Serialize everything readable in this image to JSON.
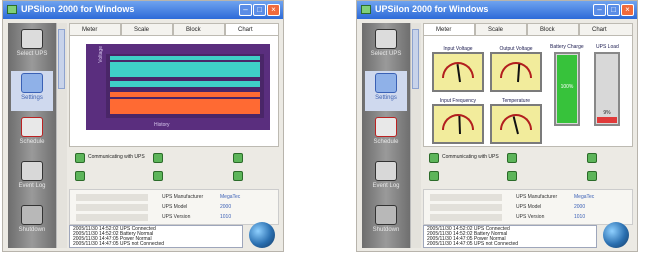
{
  "screen_left": {
    "title": "UPSilon 2000 for Windows",
    "sidebar": [
      "Select UPS",
      "Settings",
      "Schedule",
      "Event Log",
      "Shutdown"
    ],
    "tabs": [
      "Meter",
      "Scale",
      "Block",
      "Chart"
    ],
    "active_tab": "Chart",
    "chart": {
      "ylabel": "Voltage",
      "xlabel": "History"
    },
    "status": {
      "communicating": "Communicating with UPS"
    },
    "info": {
      "manufacturer_label": "UPS Manufacturer",
      "manufacturer": "MegaTec",
      "model_label": "UPS Model",
      "model": "2000",
      "version_label": "UPS Version",
      "version": "1010"
    },
    "log": [
      "2005/11/30 14:52:02  UPS Connected",
      "2005/11/30 14:52:02  Battery Normal",
      "2005/11/30 14:47:05  Power Normal",
      "2005/11/30 14:47:05  UPS not Connected"
    ]
  },
  "screen_right": {
    "title": "UPSilon 2000 for Windows",
    "sidebar": [
      "Select UPS",
      "Settings",
      "Schedule",
      "Event Log",
      "Shutdown"
    ],
    "tabs": [
      "Meter",
      "Scale",
      "Block",
      "Chart"
    ],
    "active_tab": "Meter",
    "gauges": {
      "input_voltage": "Input Voltage",
      "output_voltage": "Output Voltage",
      "input_frequency": "Input Frequency",
      "temperature": "Temperature"
    },
    "battery": {
      "label": "Battery Charge",
      "value": "100%",
      "level_fraction": 1.0
    },
    "ups_load": {
      "label": "UPS Load",
      "value": "9%",
      "level_fraction": 0.09
    },
    "status": {
      "communicating": "Communicating with UPS"
    },
    "info": {
      "manufacturer_label": "UPS Manufacturer",
      "manufacturer": "MegaTec",
      "model_label": "UPS Model",
      "model": "2000",
      "version_label": "UPS Version",
      "version": "1010"
    },
    "log": [
      "2005/11/30 14:52:02  UPS Connected",
      "2005/11/30 14:52:02  Battery Normal",
      "2005/11/30 14:47:05  Power Normal",
      "2005/11/30 14:47:05  UPS not Connected"
    ]
  },
  "colors": {
    "titlebar": "#2d6ad8",
    "chart_bg": "#5a2e7e",
    "teal": "#3fd0c7",
    "orange": "#ff6a33",
    "battery_green": "#37c23b",
    "load_red": "#e03a3a"
  }
}
